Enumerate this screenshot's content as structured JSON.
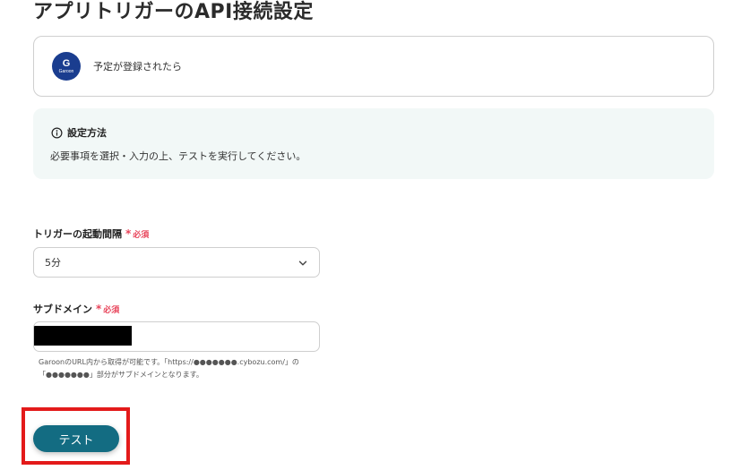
{
  "page": {
    "title": "アプリトリガーのAPI接続設定"
  },
  "trigger": {
    "app_logo_letter": "G",
    "app_logo_name": "Garoon",
    "name": "予定が登録されたら",
    "brand_color": "#1a3d8f"
  },
  "info": {
    "icon": "info-circle-icon",
    "title": "設定方法",
    "text": "必要事項を選択・入力の上、テストを実行してください。",
    "background": "#f2f8f7"
  },
  "interval_field": {
    "label": "トリガーの起動間隔",
    "required_mark": "*",
    "required_text": "必須",
    "value": "5分",
    "icon": "chevron-down-icon"
  },
  "subdomain_field": {
    "label": "サブドメイン",
    "required_mark": "*",
    "required_text": "必須",
    "helper_line1": "GaroonのURL内から取得が可能です。「https://●●●●●●●.cybozu.com/」の",
    "helper_line2": "「●●●●●●●」部分がサブドメインとなります。"
  },
  "test_button": {
    "label": "テスト",
    "color": "#136c82"
  },
  "colors": {
    "required": "#e8445a",
    "highlight": "#e31a1a"
  }
}
